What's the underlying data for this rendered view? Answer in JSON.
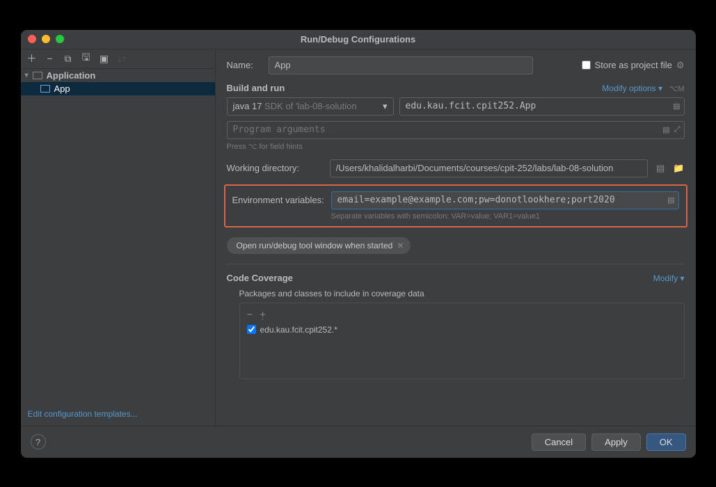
{
  "title": "Run/Debug Configurations",
  "sidebar": {
    "root": "Application",
    "items": [
      "App"
    ]
  },
  "editLink": "Edit configuration templates...",
  "form": {
    "nameLabel": "Name:",
    "nameValue": "App",
    "storeLabel": "Store as project file",
    "buildRun": "Build and run",
    "modifyOptions": "Modify options",
    "modifyOptionsKbd": "⌥M",
    "sdkPrefix": "java 17",
    "sdkSuffix": "SDK of 'lab-08-solution",
    "mainClass": "edu.kau.fcit.cpit252.App",
    "programArgsPlaceholder": "Program arguments",
    "hintsText": "Press ⌥ for field hints",
    "workingDirLabel": "Working directory:",
    "workingDirValue": "/Users/khalidalharbi/Documents/courses/cpit-252/labs/lab-08-solution",
    "envLabel": "Environment variables:",
    "envValue": "email=example@example.com;pw=donotlookhere;port2020",
    "envHint": "Separate variables with semicolon: VAR=value; VAR1=value1",
    "chip": "Open run/debug tool window when started",
    "coverageTitle": "Code Coverage",
    "modifyLink": "Modify",
    "coverageSubtitle": "Packages and classes to include in coverage data",
    "coverageItem": "edu.kau.fcit.cpit252.*"
  },
  "footer": {
    "cancel": "Cancel",
    "apply": "Apply",
    "ok": "OK"
  }
}
